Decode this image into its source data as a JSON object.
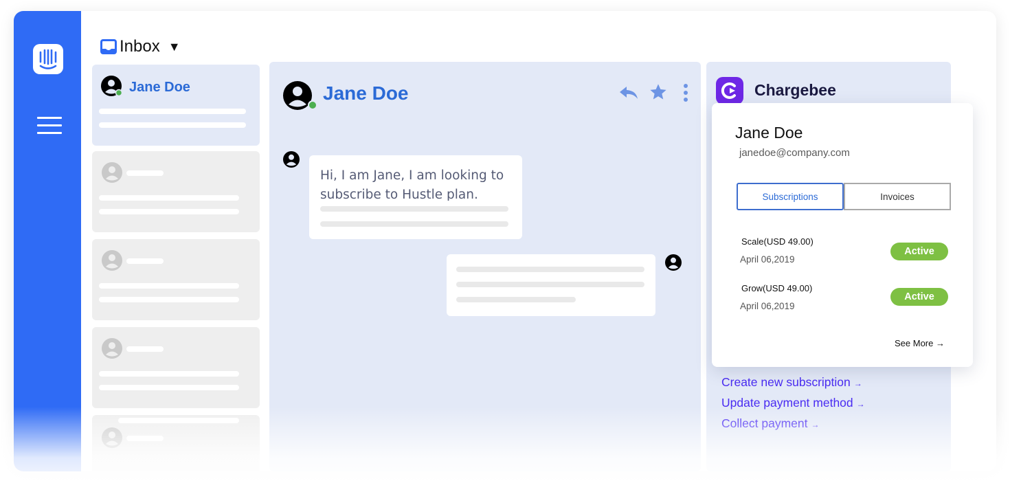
{
  "inbox": {
    "title": "Inbox",
    "caret": "▼"
  },
  "conversation_list": {
    "active_contact": "Jane Doe"
  },
  "chat": {
    "contact_name": "Jane Doe",
    "incoming_message": "Hi, I am Jane, I am looking to subscribe to Hustle plan.",
    "actions": [
      "reply-icon",
      "star-icon",
      "more-icon"
    ]
  },
  "chargebee": {
    "title": "Chargebee",
    "customer": {
      "name": "Jane Doe",
      "email": "janedoe@company.com"
    },
    "tabs": [
      {
        "label": "Subscriptions",
        "active": true
      },
      {
        "label": "Invoices",
        "active": false
      }
    ],
    "subscriptions": [
      {
        "plan": "Scale(USD 49.00)",
        "date": "April 06,2019",
        "status": "Active"
      },
      {
        "plan": "Grow(USD 49.00)",
        "date": "April 06,2019",
        "status": "Active"
      }
    ],
    "see_more": "See More",
    "links": [
      "Create new subscription",
      "Update payment method",
      "Collect payment"
    ],
    "link_arrow": "→"
  },
  "colors": {
    "sidebar": "#2f6bf5",
    "accent_blue": "#2b6ad6",
    "panel_bg": "#e3e9f7",
    "chargebee_purple": "#6e27e6",
    "link_purple": "#4a2cf2",
    "active_green": "#7ec043",
    "online_dot": "#4caf50"
  }
}
